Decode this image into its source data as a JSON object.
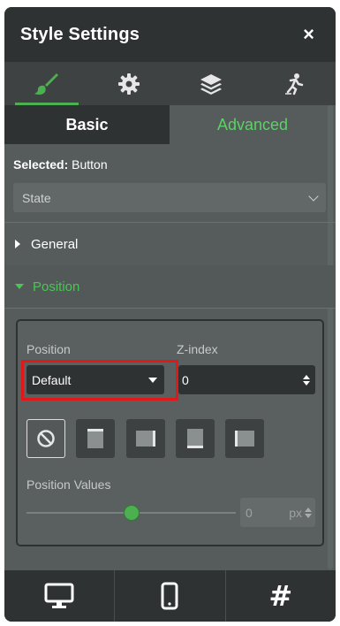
{
  "header": {
    "title": "Style Settings",
    "close_label": "×"
  },
  "icon_tabs": [
    {
      "icon": "brush-icon",
      "active": true
    },
    {
      "icon": "gear-icon",
      "active": false
    },
    {
      "icon": "layers-icon",
      "active": false
    },
    {
      "icon": "interactions-icon",
      "active": false
    }
  ],
  "sub_tabs": {
    "basic": "Basic",
    "advanced": "Advanced"
  },
  "selected": {
    "label": "Selected:",
    "value": "Button"
  },
  "state_select": {
    "value": "State"
  },
  "sections": {
    "general": "General",
    "position": "Position"
  },
  "position_panel": {
    "position_label": "Position",
    "position_value": "Default",
    "zindex_label": "Z-index",
    "zindex_value": "0",
    "position_buttons": [
      "none-icon",
      "top-icon",
      "right-icon",
      "bottom-icon",
      "left-icon"
    ],
    "values_label": "Position Values",
    "slider_value": 0.5,
    "value_field": "0",
    "value_unit": "px"
  },
  "bottom_bar": [
    "desktop-icon",
    "mobile-icon",
    "hash-icon"
  ],
  "colors": {
    "accent": "#4caf50",
    "highlight": "#e01818"
  }
}
